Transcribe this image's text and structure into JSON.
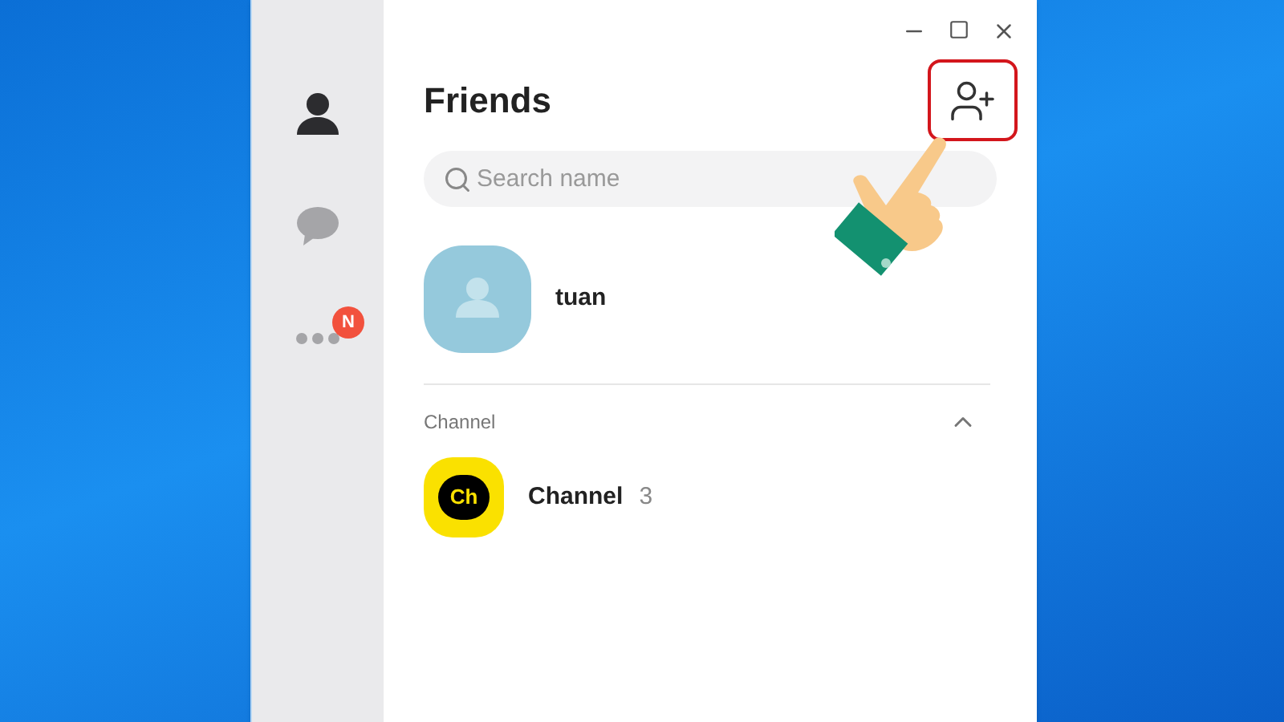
{
  "sidebar": {
    "items": [
      {
        "kind": "friends",
        "selected": true
      },
      {
        "kind": "chats",
        "selected": false
      },
      {
        "kind": "more",
        "selected": false,
        "badge": "N"
      }
    ]
  },
  "title": "Friends",
  "search": {
    "placeholder": "Search name"
  },
  "friends": [
    {
      "name": "tuan"
    }
  ],
  "sections": [
    {
      "title": "Channel",
      "expanded": true,
      "items": [
        {
          "logo_text": "Ch",
          "name": "Channel",
          "count": "3"
        }
      ]
    }
  ]
}
